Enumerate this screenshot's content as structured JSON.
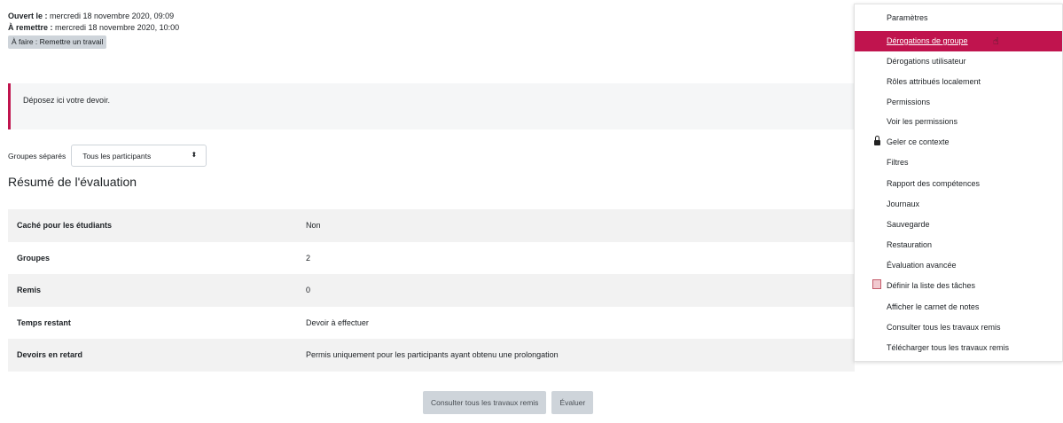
{
  "dates": {
    "opened_label": "Ouvert le :",
    "opened_value": "mercredi 18 novembre 2020, 09:09",
    "due_label": "À remettre :",
    "due_value": "mercredi 18 novembre 2020, 10:00",
    "todo_badge": "À faire : Remettre un travail"
  },
  "intro": {
    "text": "Déposez ici votre devoir."
  },
  "groups": {
    "label": "Groupes séparés",
    "selected": "Tous les participants"
  },
  "summary": {
    "title": "Résumé de l'évaluation",
    "rows": [
      {
        "label": "Caché pour les étudiants",
        "value": "Non"
      },
      {
        "label": "Groupes",
        "value": "2"
      },
      {
        "label": "Remis",
        "value": "0"
      },
      {
        "label": "Temps restant",
        "value": "Devoir à effectuer"
      },
      {
        "label": "Devoirs en retard",
        "value": "Permis uniquement pour les participants ayant obtenu une prolongation"
      }
    ]
  },
  "actions": {
    "view_all": "Consulter tous les travaux remis",
    "grade": "Évaluer"
  },
  "menu": {
    "items": [
      {
        "label": "Paramètres"
      },
      {
        "label": "Dérogations de groupe"
      },
      {
        "label": "Dérogations utilisateur"
      },
      {
        "label": "Rôles attribués localement"
      },
      {
        "label": "Permissions"
      },
      {
        "label": "Voir les permissions"
      },
      {
        "label": "Geler ce contexte",
        "icon": "lock-icon"
      },
      {
        "label": "Filtres"
      },
      {
        "label": "Rapport des compétences"
      },
      {
        "label": "Journaux"
      },
      {
        "label": "Sauvegarde"
      },
      {
        "label": "Restauration"
      },
      {
        "label": "Évaluation avancée"
      },
      {
        "label": "Définir la liste des tâches",
        "icon": "task-list-icon"
      },
      {
        "label": "Afficher le carnet de notes"
      },
      {
        "label": "Consulter tous les travaux remis"
      },
      {
        "label": "Télécharger tous les travaux remis"
      }
    ],
    "active_index": 1,
    "active_color": "#c0144e"
  }
}
